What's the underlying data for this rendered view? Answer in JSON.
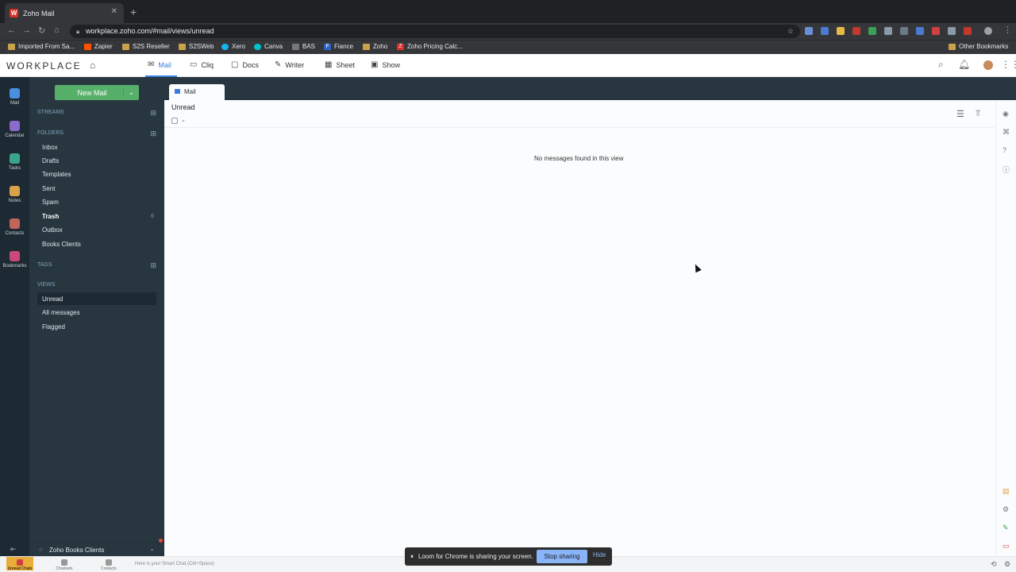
{
  "browser": {
    "tab_title": "Zoho Mail",
    "tab_favicon": "W",
    "url": "workplace.zoho.com/#mail/views/unread",
    "bookmarks": [
      "Imported From Sa...",
      "Zapier",
      "S2S Reseller",
      "S2SWeb",
      "Xero",
      "Canva",
      "BAS",
      "Fiance",
      "Zoho",
      "Zoho Pricing Calc..."
    ],
    "other_bookmarks": "Other Bookmarks"
  },
  "topbar": {
    "logo": "WORKPLACE",
    "apps": [
      "Mail",
      "Cliq",
      "Docs",
      "Writer",
      "Sheet",
      "Show"
    ],
    "active_app": "Mail"
  },
  "rail": {
    "items": [
      "Mail",
      "Calendar",
      "Tasks",
      "Notes",
      "Contacts",
      "Bookmarks"
    ]
  },
  "sidebar": {
    "new_mail": "New Mail",
    "streams_label": "STREAMS",
    "folders_label": "FOLDERS",
    "folders": [
      "Inbox",
      "Drafts",
      "Templates",
      "Sent",
      "Spam",
      "Trash",
      "Outbox",
      "Books Clients"
    ],
    "trash_count": "6",
    "tags_label": "TAGS",
    "views_label": "VIEWS",
    "views": [
      "Unread",
      "All messages",
      "Flagged"
    ],
    "bottom_label": "Zoho Books Clients"
  },
  "content": {
    "tab_label": "Mail",
    "view_title": "Unread",
    "empty_message": "No messages found in this view"
  },
  "statusbar": {
    "items": [
      "Unread Chats",
      "Channels",
      "Contacts"
    ],
    "smart_chat": "Here is your Smart Chat (Ctrl+Space)"
  },
  "toast": {
    "message": "Loom for Chrome is sharing your screen.",
    "stop": "Stop sharing",
    "hide": "Hide"
  },
  "colors": {
    "accent": "#3b7ddd",
    "new_mail_green": "#57b06a",
    "sidebar": "#283640",
    "rail": "#1e2a33"
  }
}
